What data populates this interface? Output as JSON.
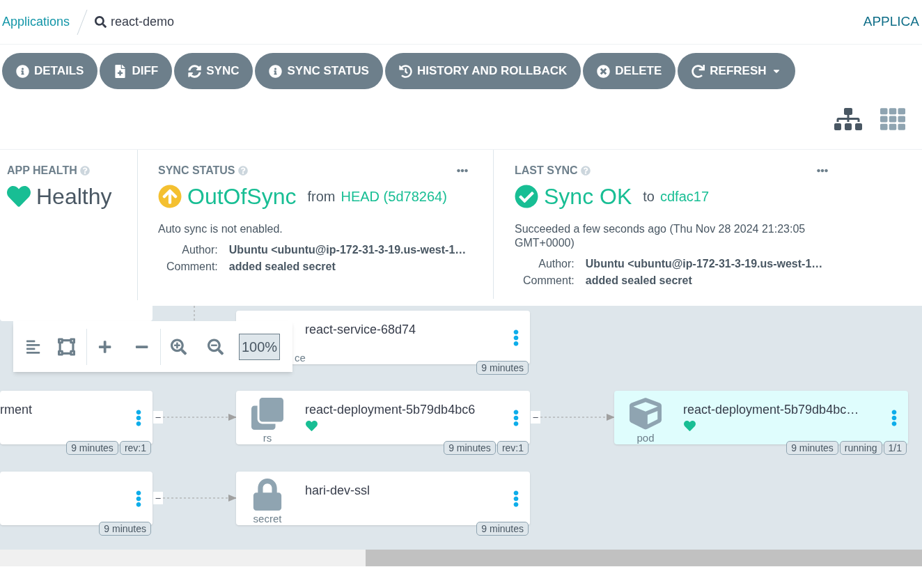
{
  "breadcrumb": {
    "root": "Applications",
    "current": "react-demo"
  },
  "header_right": "APPLICA",
  "actions": [
    {
      "label": "DETAILS",
      "has_menu": false
    },
    {
      "label": "DIFF",
      "has_menu": false
    },
    {
      "label": "SYNC",
      "has_menu": false
    },
    {
      "label": "SYNC STATUS",
      "has_menu": false
    },
    {
      "label": "HISTORY AND ROLLBACK",
      "has_menu": false
    },
    {
      "label": "DELETE",
      "has_menu": false
    },
    {
      "label": "REFRESH",
      "has_menu": true
    }
  ],
  "view_toggle": [
    {
      "kind": "tree",
      "selected": true
    },
    {
      "kind": "list",
      "selected": false
    }
  ],
  "app_health": {
    "title": "APP HEALTH",
    "status": "Healthy"
  },
  "sync_status": {
    "title": "SYNC STATUS",
    "status": "OutOfSync",
    "revision_prefix": "from",
    "revision": "HEAD (5d78264)",
    "message": "Auto sync is not enabled.",
    "fields": [
      {
        "label": "Author:",
        "value": "Ubuntu <ubuntu@ip-172-31-3-19.us-west-1…"
      },
      {
        "label": "Comment:",
        "value": "added sealed secret"
      }
    ]
  },
  "last_sync": {
    "title": "LAST SYNC",
    "status": "Sync OK",
    "revision_prefix": "to",
    "revision": "cdfac17",
    "message": "Succeeded a few seconds ago (Thu Nov 28 2024 21:23:05 GMT+0000)",
    "fields": [
      {
        "label": "Author:",
        "value": "Ubuntu <ubuntu@ip-172-31-3-19.us-west-1…"
      },
      {
        "label": "Comment:",
        "value": "added sealed secret"
      }
    ]
  },
  "graph": {
    "zoom": "100%",
    "nodes": [
      {
        "kind": "service",
        "name": "react-service-68d74",
        "kind_label": "ce",
        "healthy": false,
        "selected": false,
        "badges": [
          "9 minutes"
        ]
      },
      {
        "kind": "unknown",
        "name": "rment",
        "healthy": false,
        "selected": false,
        "collapse": "–",
        "badges": [
          "9 minutes",
          "rev:1"
        ]
      },
      {
        "kind": "replicaset",
        "name": "react-deployment-5b79db4bc6",
        "kind_label": "rs",
        "healthy": true,
        "selected": false,
        "collapse": "–",
        "badges": [
          "9 minutes",
          "rev:1"
        ]
      },
      {
        "kind": "pod",
        "name": "react-deployment-5b79db4bc…",
        "kind_label": "pod",
        "healthy": true,
        "selected": true,
        "badges": [
          "9 minutes",
          "running",
          "1/1"
        ]
      },
      {
        "kind": "unknown",
        "healthy": false,
        "selected": false,
        "collapse": "–",
        "badges": [
          "9 minutes"
        ]
      },
      {
        "kind": "secret",
        "name": "hari-dev-ssl",
        "kind_label": "secret",
        "healthy": false,
        "selected": false,
        "badges": [
          "9 minutes"
        ]
      }
    ]
  }
}
